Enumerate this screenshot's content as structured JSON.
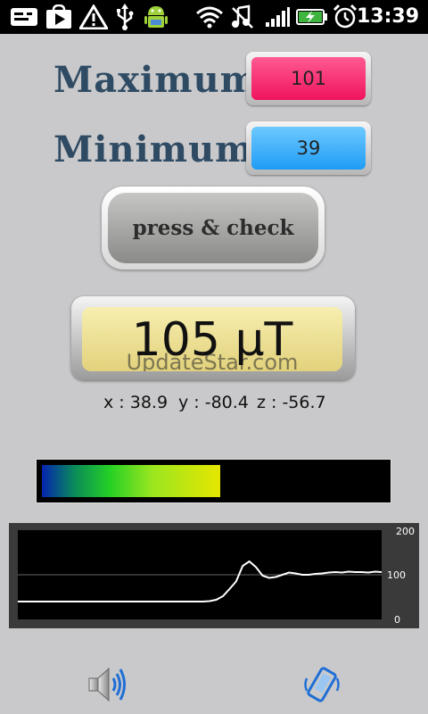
{
  "status_bar": {
    "time": "13:39",
    "icons": [
      "message-icon",
      "play-store-icon",
      "warning-icon",
      "usb-icon",
      "android-icon",
      "wifi-icon",
      "music-off-icon",
      "signal-icon",
      "battery-charging-icon",
      "alarm-icon"
    ]
  },
  "maximum": {
    "label": "Maximum :",
    "value": "101",
    "color": "#f0135e"
  },
  "minimum": {
    "label": "Minimum :",
    "value": "39",
    "color": "#1f9cf6"
  },
  "check_button": {
    "label": "press & check"
  },
  "reading": {
    "value": "105 μT",
    "watermark": "UpdateStar.com"
  },
  "axes": {
    "x": "x : 38.9",
    "y": "y : -80.4",
    "z": "z : -56.7"
  },
  "meter": {
    "level": 0.52
  },
  "chart_data": {
    "type": "line",
    "ylim": [
      0,
      200
    ],
    "y_ticks": [
      "200",
      "100",
      "0"
    ],
    "series": [
      {
        "values": [
          40,
          40,
          40,
          40,
          40,
          40,
          40,
          40,
          40,
          40,
          40,
          40,
          40,
          40,
          40,
          40,
          40,
          40,
          40,
          40,
          40,
          40,
          40,
          40,
          40,
          40,
          40,
          40,
          40,
          41,
          44,
          52,
          68,
          85,
          120,
          130,
          117,
          98,
          93,
          95,
          100,
          105,
          103,
          100,
          100,
          102,
          103,
          105,
          106,
          105,
          107,
          106,
          106,
          105,
          107,
          106
        ]
      }
    ]
  },
  "bottom": {
    "sound_icon": "speaker-icon",
    "vibrate_icon": "vibrate-icon"
  }
}
